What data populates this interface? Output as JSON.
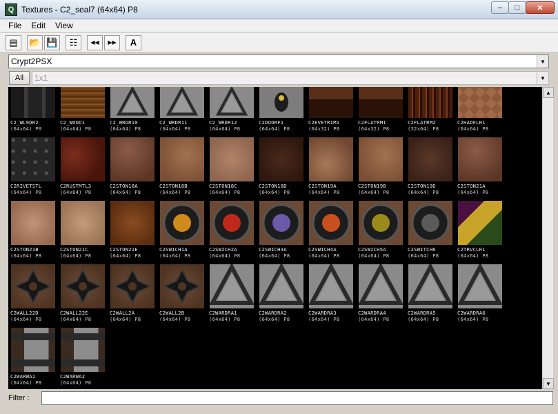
{
  "window": {
    "title": "Textures - C2_seal7 (64x64) P8",
    "app_icon_glyph": "Q"
  },
  "window_buttons": {
    "minimize": "‒",
    "maximize": "□",
    "close": "✕"
  },
  "menu": [
    {
      "label": "File"
    },
    {
      "label": "Edit"
    },
    {
      "label": "View"
    }
  ],
  "toolbar": [
    {
      "icon": "browse-tree-icon",
      "glyph": "▤"
    },
    {
      "icon": "open-folder-icon",
      "glyph": "📂"
    },
    {
      "icon": "save-icon",
      "glyph": "💾"
    },
    {
      "icon": "properties-icon",
      "glyph": "☷"
    },
    {
      "icon": "previous-icon",
      "glyph": "◀◀"
    },
    {
      "icon": "next-icon",
      "glyph": "▶▶"
    },
    {
      "icon": "font-icon",
      "glyph": "A"
    }
  ],
  "package_combo": {
    "value": "Crypt2PSX"
  },
  "group": {
    "all_label": "All",
    "value": "1x1"
  },
  "filter": {
    "label": "Filter :",
    "value": ""
  },
  "textures": [
    {
      "name": "C2_WL9DR2",
      "dims": "(64x64) P8",
      "style": "t-pillar"
    },
    {
      "name": "C2_WOOD1",
      "dims": "(64x64) P8",
      "style": "t-wood"
    },
    {
      "name": "C2_WRDR10",
      "dims": "(64x64) P8",
      "style": "t-ward"
    },
    {
      "name": "C2_WRDR11",
      "dims": "(64x64) P8",
      "style": "t-ward"
    },
    {
      "name": "C2_WRDR12",
      "dims": "(64x64) P8",
      "style": "t-ward"
    },
    {
      "name": "C2DOORF1",
      "dims": "(64x64) P8",
      "style": "t-door"
    },
    {
      "name": "C2EVETRIM1",
      "dims": "(64x32) P8",
      "style": "t-trim"
    },
    {
      "name": "C2FLATRM1",
      "dims": "(64x32) P8",
      "style": "t-trim"
    },
    {
      "name": "C2FLATRM2",
      "dims": "(32x64) P8",
      "style": "t-flatrm"
    },
    {
      "name": "C2HADFLR1",
      "dims": "(64x64) P8",
      "style": "t-flr"
    },
    {
      "name": "C2RIVETSTL",
      "dims": "(64x64) P8",
      "style": "t-rivet"
    },
    {
      "name": "C2RUSTMTL3",
      "dims": "(64x64) P8",
      "style": "t-rust"
    },
    {
      "name": "C2STON18A",
      "dims": "(64x64) P8",
      "style": "t-ston-a"
    },
    {
      "name": "C2STON18B",
      "dims": "(64x64) P8",
      "style": "t-ston-b"
    },
    {
      "name": "C2STON18C",
      "dims": "(64x64) P8",
      "style": "t-ston-c"
    },
    {
      "name": "C2STON18D",
      "dims": "(64x64) P8",
      "style": "t-ston-d"
    },
    {
      "name": "C2STON19A",
      "dims": "(64x64) P8",
      "style": "t-ston-e"
    },
    {
      "name": "C2STON19B",
      "dims": "(64x64) P8",
      "style": "t-ston-b"
    },
    {
      "name": "C2STON19D",
      "dims": "(64x64) P8",
      "style": "t-ston-f"
    },
    {
      "name": "C2STON21A",
      "dims": "(64x64) P8",
      "style": "t-ston-a"
    },
    {
      "name": "C2STON21B",
      "dims": "(64x64) P8",
      "style": "t-ston-g"
    },
    {
      "name": "C2STON21C",
      "dims": "(64x64) P8",
      "style": "t-ston-h"
    },
    {
      "name": "C2STON21E",
      "dims": "(64x64) P8",
      "style": "t-ston-i"
    },
    {
      "name": "C2SWICH1A",
      "dims": "(64x64) P8",
      "style": "t-switch",
      "rune": "#d08a1c"
    },
    {
      "name": "C2SWICH2A",
      "dims": "(64x64) P8",
      "style": "t-switch",
      "rune": "#c0281c"
    },
    {
      "name": "C2SWICH3A",
      "dims": "(64x64) P8",
      "style": "t-switch",
      "rune": "#6a5aa8"
    },
    {
      "name": "C2SWICH4A",
      "dims": "(64x64) P8",
      "style": "t-switch",
      "rune": "#c8501c"
    },
    {
      "name": "C2SWICH5A",
      "dims": "(64x64) P8",
      "style": "t-switch",
      "rune": "#9a8a1c"
    },
    {
      "name": "C2SWITCH6",
      "dims": "(64x64) P8",
      "style": "t-switch",
      "rune": "#5a5a5a"
    },
    {
      "name": "C2TRVCLR1",
      "dims": "(64x64) P8",
      "style": "t-trvclr"
    },
    {
      "name": "C2WALL22D",
      "dims": "(64x64) P8",
      "style": "t-wall"
    },
    {
      "name": "C2WALL22E",
      "dims": "(64x64) P8",
      "style": "t-wall"
    },
    {
      "name": "C2WALL2A",
      "dims": "(64x64) P8",
      "style": "t-wall"
    },
    {
      "name": "C2WALL2B",
      "dims": "(64x64) P8",
      "style": "t-wall"
    },
    {
      "name": "C2WARDRA1",
      "dims": "(64x64) P8",
      "style": "t-ward"
    },
    {
      "name": "C2WARDRA2",
      "dims": "(64x64) P8",
      "style": "t-ward"
    },
    {
      "name": "C2WARDRA3",
      "dims": "(64x64) P8",
      "style": "t-ward"
    },
    {
      "name": "C2WARDRA4",
      "dims": "(64x64) P8",
      "style": "t-ward"
    },
    {
      "name": "C2WARDRA5",
      "dims": "(64x64) P8",
      "style": "t-ward"
    },
    {
      "name": "C2WARDRA6",
      "dims": "(64x64) P8",
      "style": "t-ward"
    },
    {
      "name": "C2WARWA1",
      "dims": "(64x64) P8",
      "style": "t-warw"
    },
    {
      "name": "C2WARWA2",
      "dims": "(64x64) P8",
      "style": "t-warw"
    }
  ],
  "scrollbar": {
    "up": "▲",
    "down": "▼"
  },
  "combo_arrow": "▼"
}
